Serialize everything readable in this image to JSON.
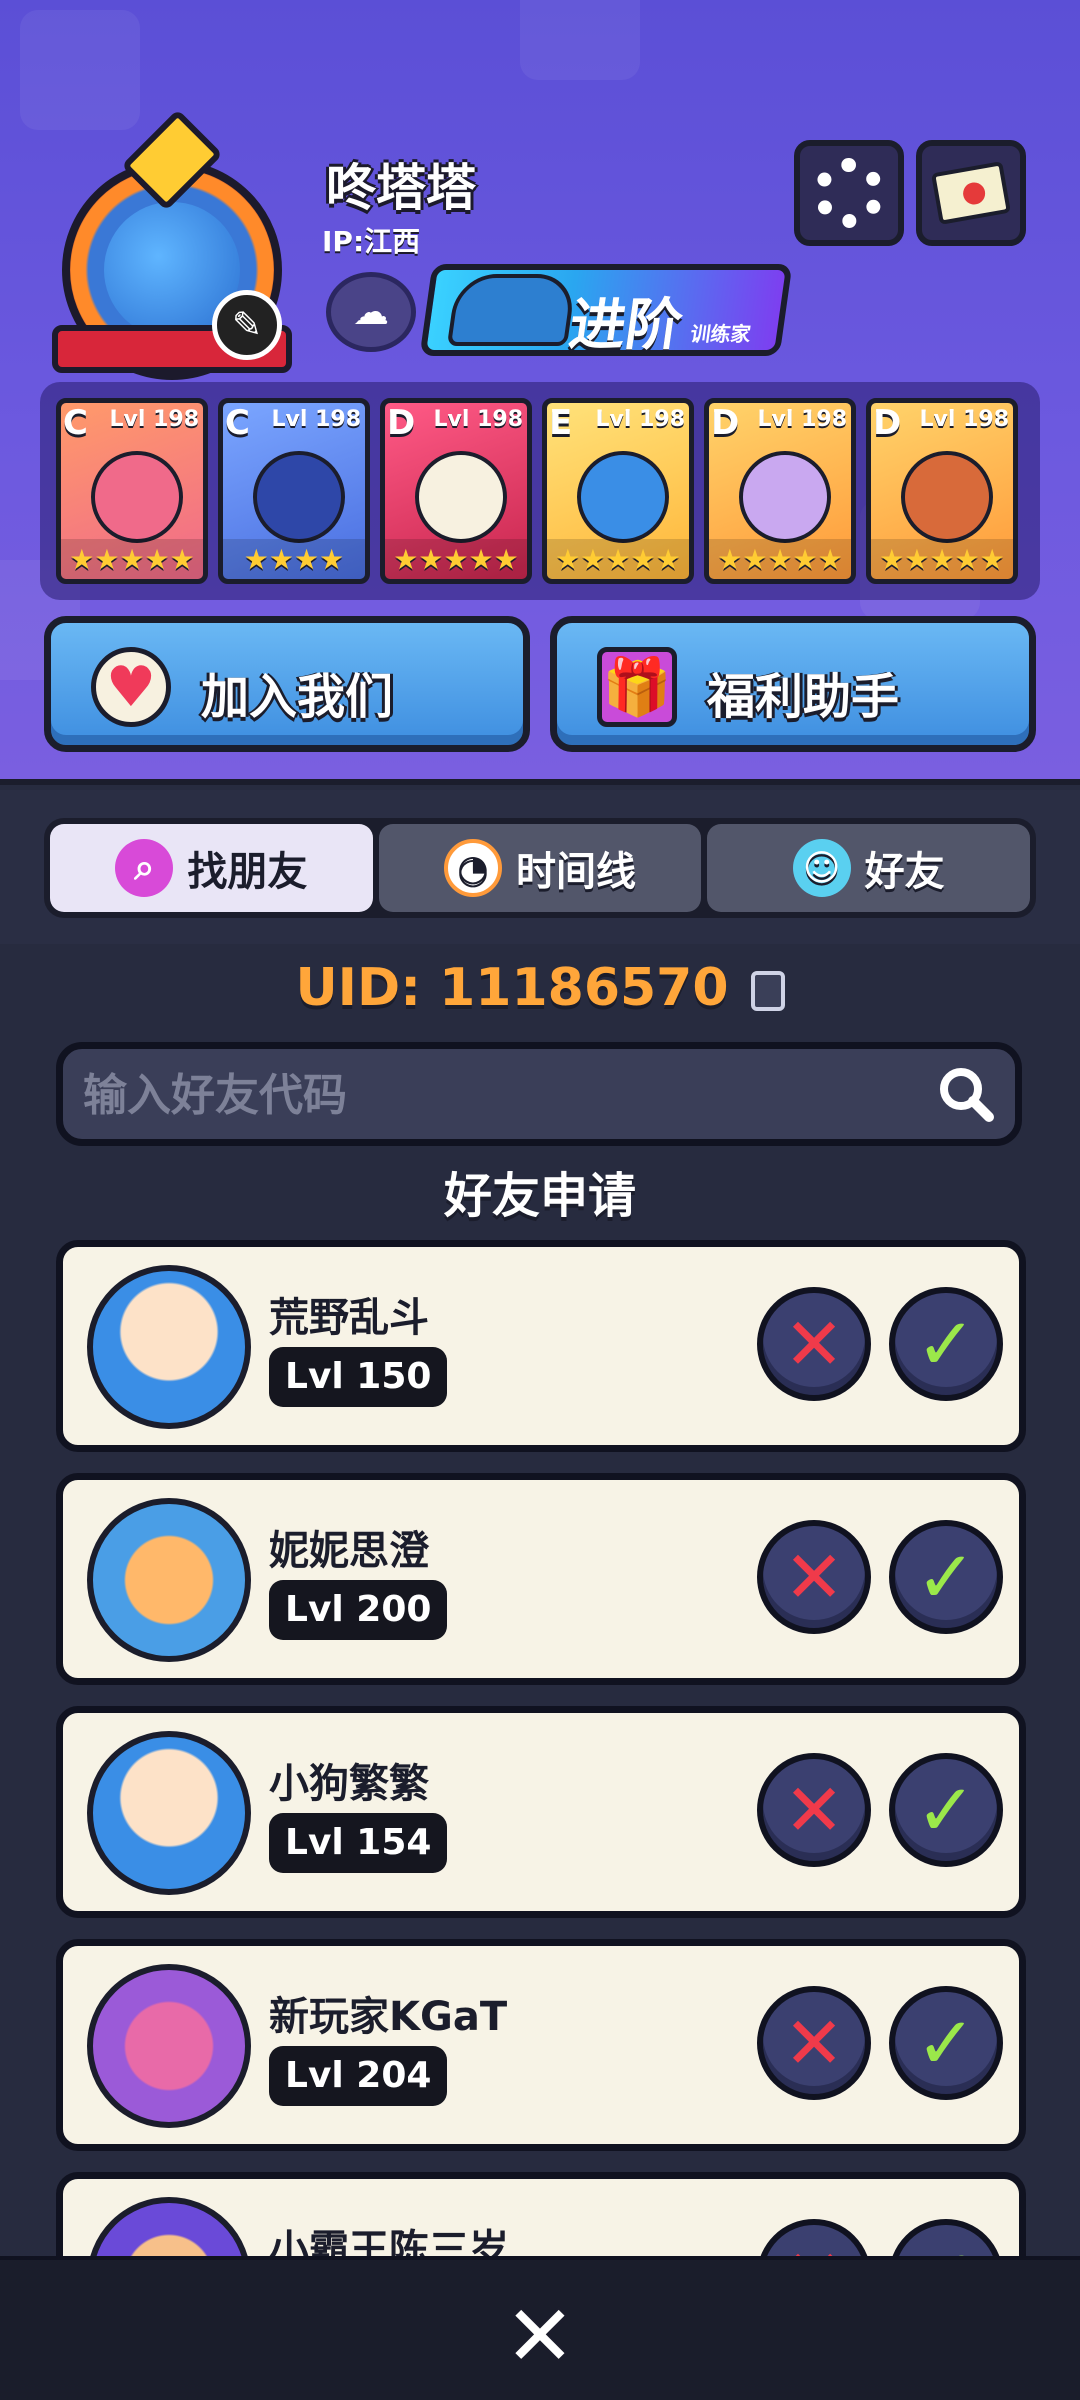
{
  "profile": {
    "username": "咚塔塔",
    "ip_label": "IP:江西",
    "advance_label": "进阶",
    "advance_sub": "训练家"
  },
  "team": [
    {
      "grade": "C",
      "level": "Lvl 198",
      "stars": "★★★★★",
      "color": "#f06a8a"
    },
    {
      "grade": "C",
      "level": "Lvl 198",
      "stars": "★★★★",
      "color": "#4a6ee0"
    },
    {
      "grade": "D",
      "level": "Lvl 198",
      "stars": "★★★★★",
      "color": "#e8457a"
    },
    {
      "grade": "E",
      "level": "Lvl 198",
      "stars": "★★★★★",
      "color": "#ffcf3a"
    },
    {
      "grade": "D",
      "level": "Lvl 198",
      "stars": "★★★★★",
      "color": "#ffb63a"
    },
    {
      "grade": "D",
      "level": "Lvl 198",
      "stars": "★★★★★",
      "color": "#ff9a3a"
    }
  ],
  "actions": {
    "join_label": "加入我们",
    "welfare_label": "福利助手"
  },
  "tabs": [
    {
      "label": "找朋友",
      "icon": "magnifier-icon",
      "active": true
    },
    {
      "label": "时间线",
      "icon": "clock-icon",
      "active": false
    },
    {
      "label": "好友",
      "icon": "chat-ghost-icon",
      "active": false
    }
  ],
  "uid": {
    "text": "UID:  11186570"
  },
  "search": {
    "placeholder": "输入好友代码"
  },
  "section_title": "好友申请",
  "requests": [
    {
      "name": "荒野乱斗",
      "level": "Lvl 150"
    },
    {
      "name": "妮妮思澄",
      "level": "Lvl 200"
    },
    {
      "name": "小狗繁繁",
      "level": "Lvl 154"
    },
    {
      "name": "新玩家KGaT",
      "level": "Lvl 204"
    },
    {
      "name": "小霸王陈三岁",
      "level": ""
    }
  ],
  "colors": {
    "header_bg": "#6c59df",
    "content_bg": "#272b3f",
    "uid_orange": "#ffa63a",
    "reject_red": "#f03a4a",
    "accept_green": "#9be84a"
  }
}
